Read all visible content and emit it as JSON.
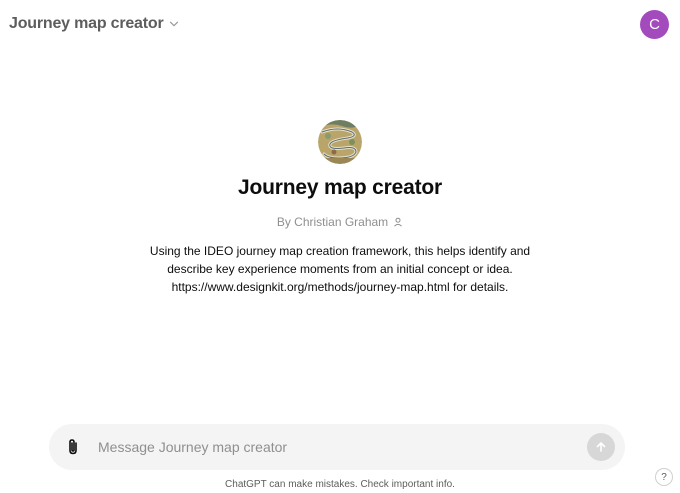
{
  "header": {
    "title": "Journey map creator",
    "chevron_icon": "chevron-down-icon",
    "avatar_initial": "C",
    "avatar_color": "#a34bbd"
  },
  "gpt": {
    "image_icon": "gpt-profile-image",
    "name": "Journey map creator",
    "byline": "By Christian Graham",
    "byline_icon": "person-icon",
    "description": "Using the IDEO journey map creation framework, this helps identify and describe key experience moments from an initial concept or idea. https://www.designkit.org/methods/journey-map.html for details."
  },
  "composer": {
    "placeholder": "Message Journey map creator",
    "value": "",
    "attach_icon": "paperclip-icon",
    "send_icon": "arrow-up-icon"
  },
  "footer": {
    "note": "ChatGPT can make mistakes. Check important info.",
    "help_label": "?"
  }
}
